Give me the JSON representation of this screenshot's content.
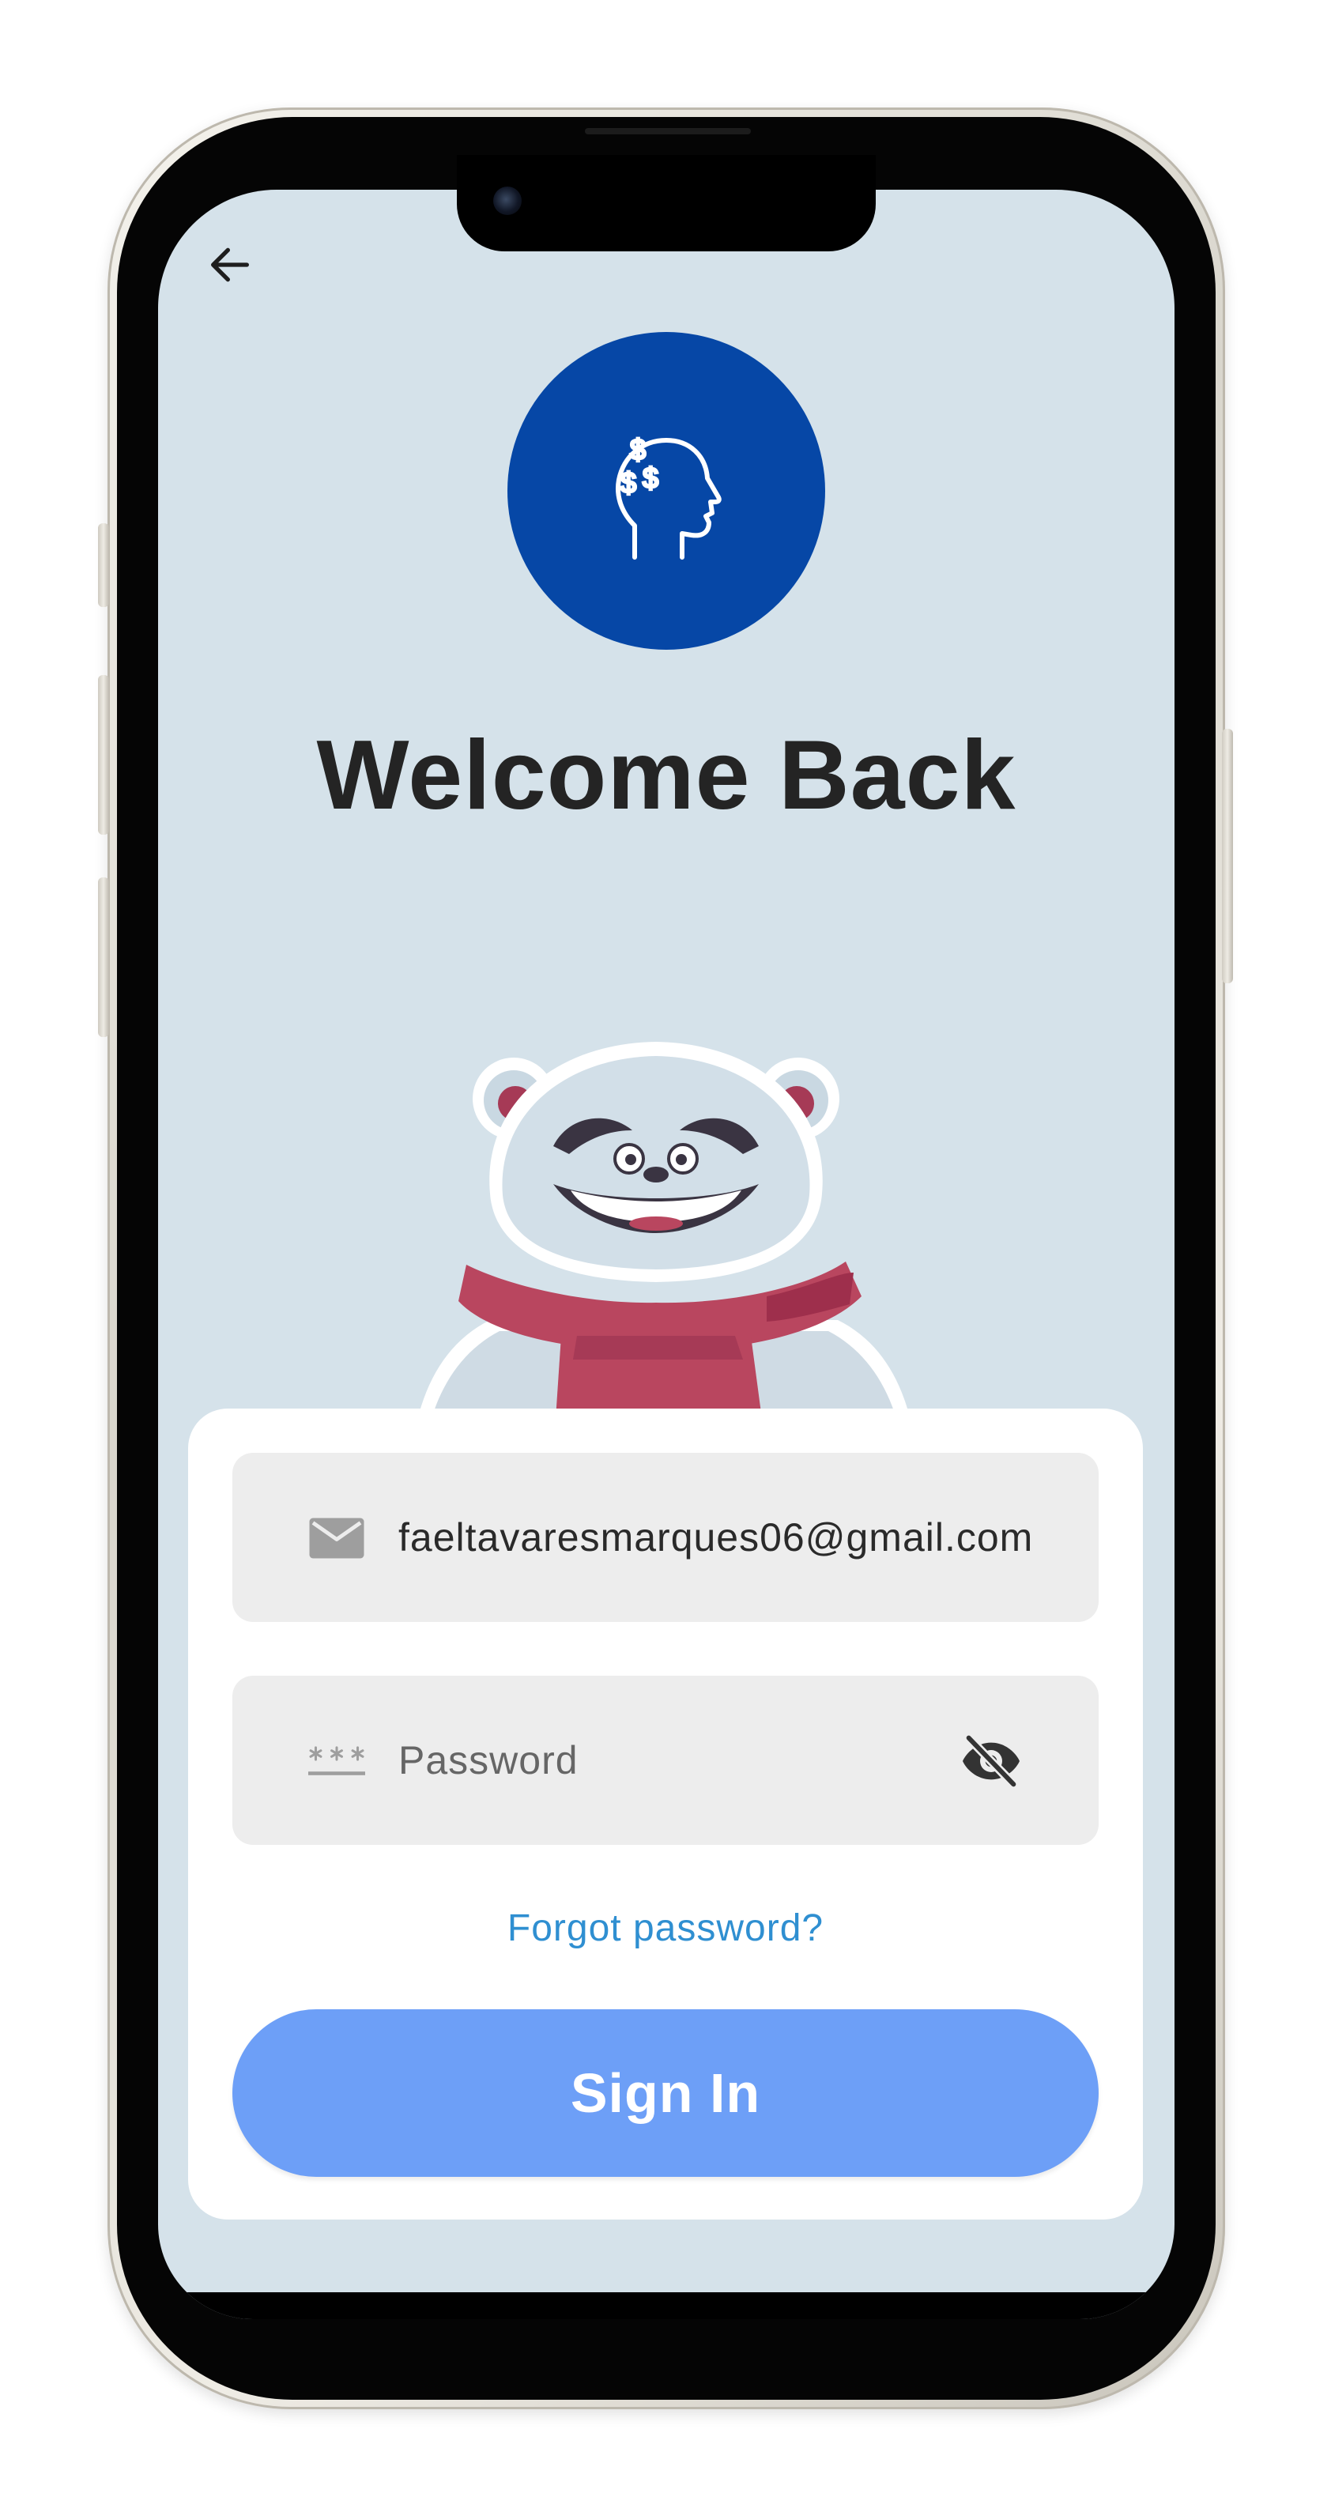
{
  "header": {
    "back_icon": "arrow-left-icon",
    "logo_icon": "head-dollar-icon",
    "title": "Welcome Back"
  },
  "mascot": {
    "icon": "polar-bear-scarf-mascot"
  },
  "form": {
    "email": {
      "icon": "mail-icon",
      "value": "faeltavaresmarques06@gmail.com"
    },
    "password": {
      "icon": "password-dots-icon",
      "placeholder": "Password",
      "value": "",
      "visibility_icon": "eye-off-icon"
    },
    "forgot_label": "Forgot password?",
    "signin_label": "Sign In"
  },
  "colors": {
    "screen_background": "#d5e2ea",
    "logo_circle": "#0647a6",
    "title_text": "#242424",
    "card_background": "#ffffff",
    "field_background": "#ededed",
    "link": "#2f8fd1",
    "button_primary": "#6d9ff7",
    "scarf": "#b9465f"
  }
}
